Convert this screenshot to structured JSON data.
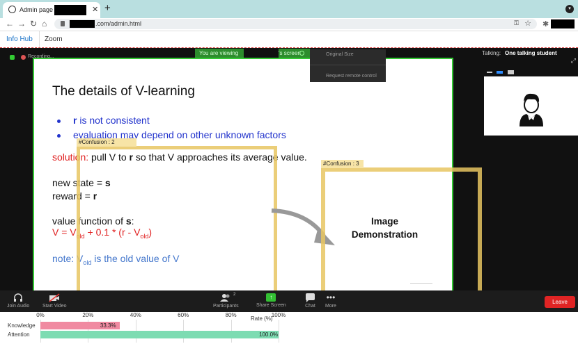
{
  "browser": {
    "tab_title": "Admin page of",
    "tab_close": "✕",
    "new_tab": "+",
    "url": ".com/admin.html"
  },
  "app_tabs": [
    {
      "label": "Info Hub"
    },
    {
      "label": "Zoom"
    }
  ],
  "zoom": {
    "viewing_text_1": "You are viewing",
    "viewing_text_2": "'s screen",
    "recording": "Recording...",
    "menu_items": [
      "Original Size",
      "Request remote control"
    ],
    "talking_label": "Talking:",
    "talking_name": "One talking student",
    "slide": {
      "title": "The details of V-learning",
      "bullets": [
        {
          "bold": "r",
          "text": " is not consistent"
        },
        {
          "text": "evaluation may depend on other unknown factors"
        }
      ],
      "solution_label": "solution:",
      "solution_text_1": " pull V to ",
      "solution_bold": "r",
      "solution_text_2": " so that V approaches its average value.",
      "new_state_text": "new state = ",
      "new_state_bold": "s",
      "reward_text": "reward = ",
      "reward_bold": "r",
      "value_fn_text": "value function of ",
      "value_fn_bold": "s",
      "value_fn_colon": ":",
      "eq_a": "V = V",
      "eq_sub1": "old",
      "eq_b": " + 0.1 * (r - V",
      "eq_sub2": "old",
      "eq_c": ")",
      "note_a": "note: V",
      "note_sub": "old",
      "note_b": " is the old value of V"
    },
    "confusion_labels": [
      "#Confusion : 2",
      "#Confusion : 3"
    ],
    "image_demo": [
      "Image",
      "Demonstration"
    ],
    "toolbar": {
      "join_audio": "Join Audio",
      "start_video": "Start Video",
      "participants": "Participants",
      "participants_count": "2",
      "share_screen": "Share Screen",
      "chat": "Chat",
      "more": "More",
      "leave": "Leave"
    }
  },
  "chart_data": {
    "type": "bar",
    "orientation": "horizontal",
    "categories": [
      "Knowledge",
      "Attention"
    ],
    "values": [
      33.3,
      100.0
    ],
    "value_labels": [
      "33.3%",
      "100.0%"
    ],
    "xlabel": "Rate (%)",
    "xlim": [
      0,
      100
    ],
    "xticks": [
      "0%",
      "20%",
      "40%",
      "60%",
      "80%",
      "100%"
    ],
    "colors": [
      "#f08aa1",
      "#7ddcb2"
    ]
  }
}
